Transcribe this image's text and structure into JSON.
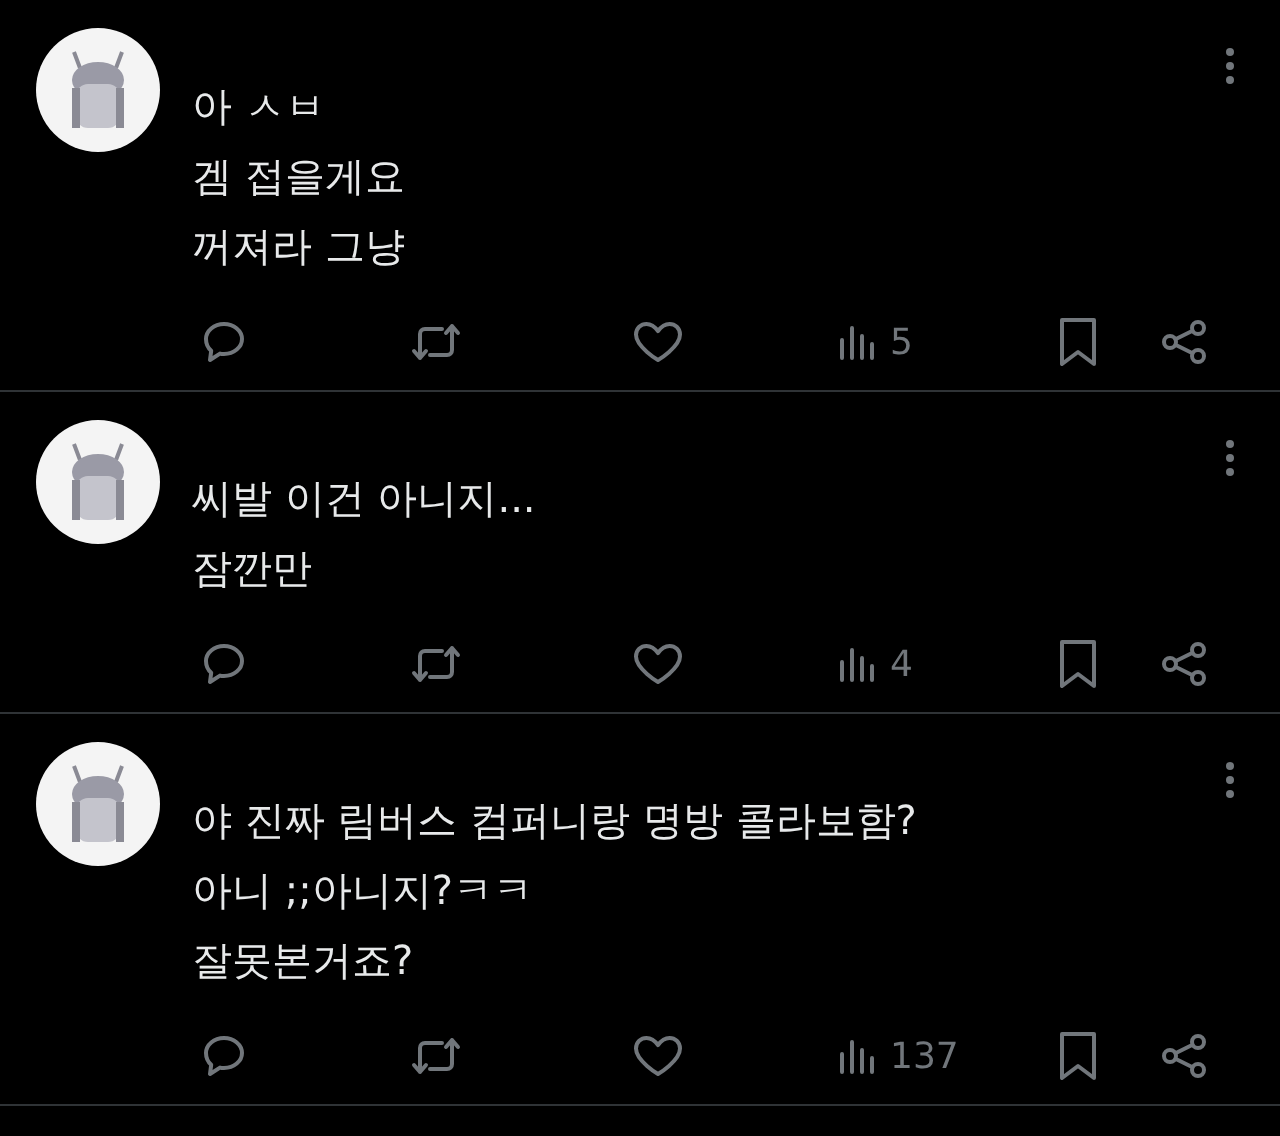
{
  "posts": [
    {
      "lines": [
        "아 ㅅㅂ",
        "겜 접을게요",
        "꺼져라 그냥"
      ],
      "views": "5"
    },
    {
      "lines": [
        "씨발 이건 아니지...",
        "잠깐만"
      ],
      "views": "4"
    },
    {
      "lines": [
        "야 진짜 림버스 컴퍼니랑 명방 콜라보함?",
        "아니 ;;아니지?ㅋㅋ",
        "잘못본거죠?"
      ],
      "views": "137"
    }
  ]
}
